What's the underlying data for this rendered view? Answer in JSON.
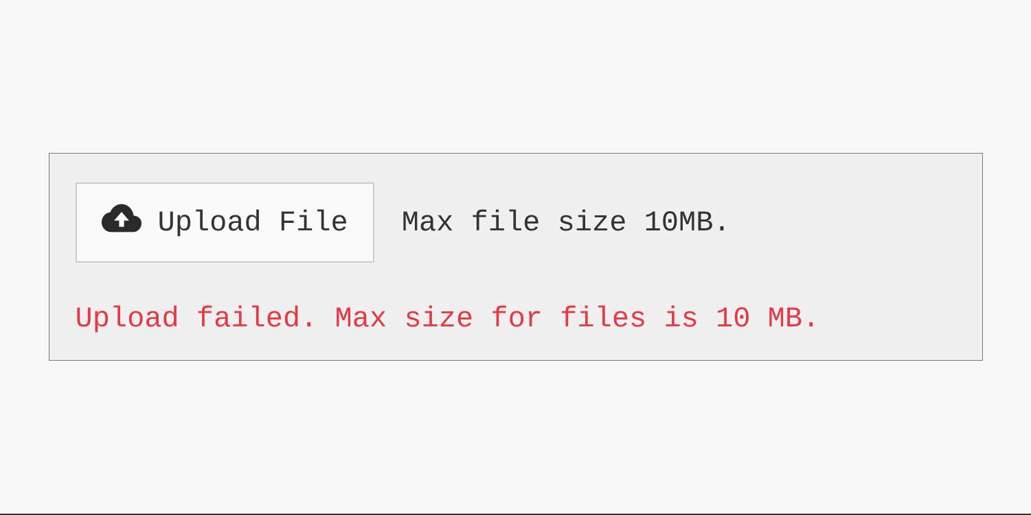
{
  "upload": {
    "button_label": "Upload File",
    "hint": "Max file size 10MB.",
    "error": "Upload failed. Max size for files is 10 MB.",
    "icon": "cloud-upload-icon"
  },
  "colors": {
    "error": "#e63946",
    "text": "#333333",
    "border": "#777777",
    "button_border": "#cccccc",
    "page_bg": "#f8f8f8",
    "container_bg": "#f0f0f0",
    "button_bg": "#fafafa"
  }
}
